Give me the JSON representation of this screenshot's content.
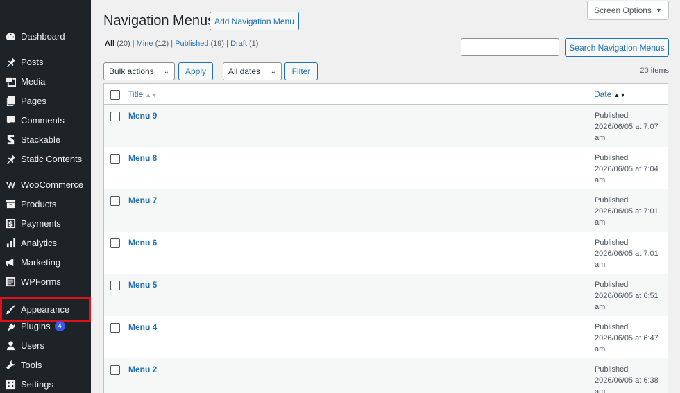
{
  "sidebar": {
    "items": [
      {
        "label": "Dashboard",
        "icon": "dashboard-icon"
      },
      {
        "label": "Posts",
        "icon": "pushpin-icon"
      },
      {
        "label": "Media",
        "icon": "media-icon"
      },
      {
        "label": "Pages",
        "icon": "pages-icon"
      },
      {
        "label": "Comments",
        "icon": "comment-icon"
      },
      {
        "label": "Stackable",
        "icon": "stackable-icon"
      },
      {
        "label": "Static Contents",
        "icon": "pushpin-icon"
      },
      {
        "label": "WooCommerce",
        "icon": "woocommerce-icon"
      },
      {
        "label": "Products",
        "icon": "archive-icon"
      },
      {
        "label": "Payments",
        "icon": "dollar-icon"
      },
      {
        "label": "Analytics",
        "icon": "bar-chart-icon"
      },
      {
        "label": "Marketing",
        "icon": "megaphone-icon"
      },
      {
        "label": "WPForms",
        "icon": "form-icon"
      },
      {
        "label": "Appearance",
        "icon": "paintbrush-icon"
      },
      {
        "label": "Plugins",
        "icon": "plug-icon",
        "badge": "4"
      },
      {
        "label": "Users",
        "icon": "user-icon"
      },
      {
        "label": "Tools",
        "icon": "wrench-icon"
      },
      {
        "label": "Settings",
        "icon": "settings-icon"
      }
    ]
  },
  "header": {
    "title": "Navigation Menus",
    "add_button": "Add Navigation Menu",
    "screen_options": "Screen Options"
  },
  "filters": {
    "views": [
      {
        "label": "All",
        "count": "(20)"
      },
      {
        "label": "Mine",
        "count": "(12)"
      },
      {
        "label": "Published",
        "count": "(19)"
      },
      {
        "label": "Draft",
        "count": "(1)"
      }
    ],
    "search_button": "Search Navigation Menus",
    "search_value": "",
    "bulk_actions": "Bulk actions",
    "apply": "Apply",
    "all_dates": "All dates",
    "filter": "Filter",
    "items_count": "20 items"
  },
  "table": {
    "columns": {
      "title": "Title",
      "date": "Date"
    },
    "rows": [
      {
        "title": "Menu 9",
        "status": "Published",
        "date": "2026/06/05 at 7:07",
        "ampm": "am"
      },
      {
        "title": "Menu 8",
        "status": "Published",
        "date": "2026/06/05 at 7:04",
        "ampm": "am"
      },
      {
        "title": "Menu 7",
        "status": "Published",
        "date": "2026/06/05 at 7:01",
        "ampm": "am"
      },
      {
        "title": "Menu 6",
        "status": "Published",
        "date": "2026/06/05 at 7:01",
        "ampm": "am"
      },
      {
        "title": "Menu 5",
        "status": "Published",
        "date": "2026/06/05 at 6:51",
        "ampm": "am"
      },
      {
        "title": "Menu 4",
        "status": "Published",
        "date": "2026/06/05 at 6:47",
        "ampm": "am"
      },
      {
        "title": "Menu 2",
        "status": "Published",
        "date": "2026/06/05 at 6:38",
        "ampm": "am"
      }
    ]
  },
  "colors": {
    "sidebar_bg": "#1d2327",
    "link": "#2271b1",
    "highlight": "#e1101a",
    "badge": "#3858e9"
  }
}
